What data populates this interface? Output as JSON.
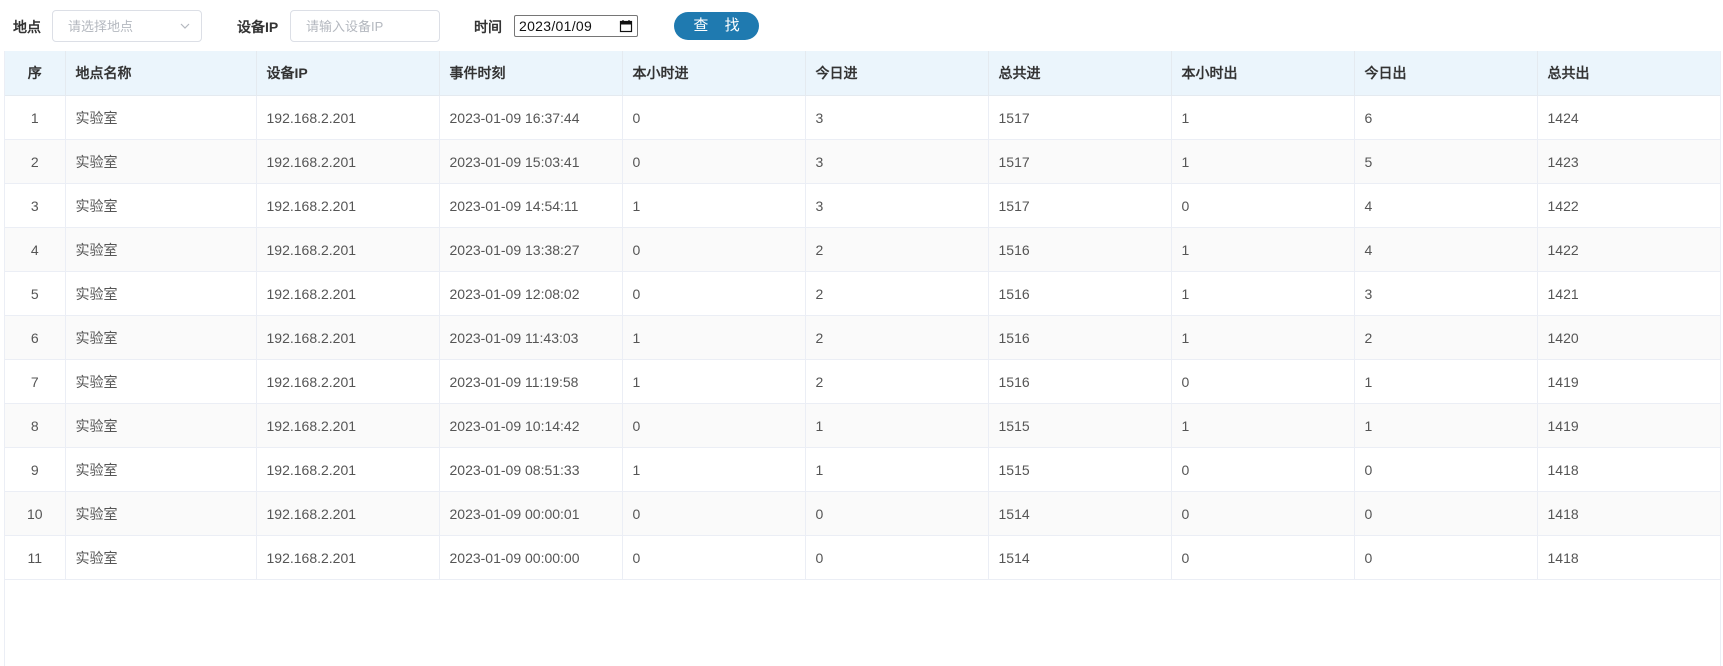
{
  "filters": {
    "location": {
      "label": "地点",
      "placeholder": "请选择地点"
    },
    "device_ip": {
      "label": "设备IP",
      "placeholder": "请输入设备IP",
      "value": ""
    },
    "time": {
      "label": "时间",
      "value": "2023/01/09"
    },
    "search_label": "查 找"
  },
  "colors": {
    "accent": "#1f7ab0",
    "header_bg": "#ebf5fc",
    "stripe_bg": "#fafafa"
  },
  "table": {
    "columns": [
      "序",
      "地点名称",
      "设备IP",
      "事件时刻",
      "本小时进",
      "今日进",
      "总共进",
      "本小时出",
      "今日出",
      "总共出"
    ],
    "rows": [
      [
        "1",
        "实验室",
        "192.168.2.201",
        "2023-01-09 16:37:44",
        "0",
        "3",
        "1517",
        "1",
        "6",
        "1424"
      ],
      [
        "2",
        "实验室",
        "192.168.2.201",
        "2023-01-09 15:03:41",
        "0",
        "3",
        "1517",
        "1",
        "5",
        "1423"
      ],
      [
        "3",
        "实验室",
        "192.168.2.201",
        "2023-01-09 14:54:11",
        "1",
        "3",
        "1517",
        "0",
        "4",
        "1422"
      ],
      [
        "4",
        "实验室",
        "192.168.2.201",
        "2023-01-09 13:38:27",
        "0",
        "2",
        "1516",
        "1",
        "4",
        "1422"
      ],
      [
        "5",
        "实验室",
        "192.168.2.201",
        "2023-01-09 12:08:02",
        "0",
        "2",
        "1516",
        "1",
        "3",
        "1421"
      ],
      [
        "6",
        "实验室",
        "192.168.2.201",
        "2023-01-09 11:43:03",
        "1",
        "2",
        "1516",
        "1",
        "2",
        "1420"
      ],
      [
        "7",
        "实验室",
        "192.168.2.201",
        "2023-01-09 11:19:58",
        "1",
        "2",
        "1516",
        "0",
        "1",
        "1419"
      ],
      [
        "8",
        "实验室",
        "192.168.2.201",
        "2023-01-09 10:14:42",
        "0",
        "1",
        "1515",
        "1",
        "1",
        "1419"
      ],
      [
        "9",
        "实验室",
        "192.168.2.201",
        "2023-01-09 08:51:33",
        "1",
        "1",
        "1515",
        "0",
        "0",
        "1418"
      ],
      [
        "10",
        "实验室",
        "192.168.2.201",
        "2023-01-09 00:00:01",
        "0",
        "0",
        "1514",
        "0",
        "0",
        "1418"
      ],
      [
        "11",
        "实验室",
        "192.168.2.201",
        "2023-01-09 00:00:00",
        "0",
        "0",
        "1514",
        "0",
        "0",
        "1418"
      ]
    ]
  }
}
